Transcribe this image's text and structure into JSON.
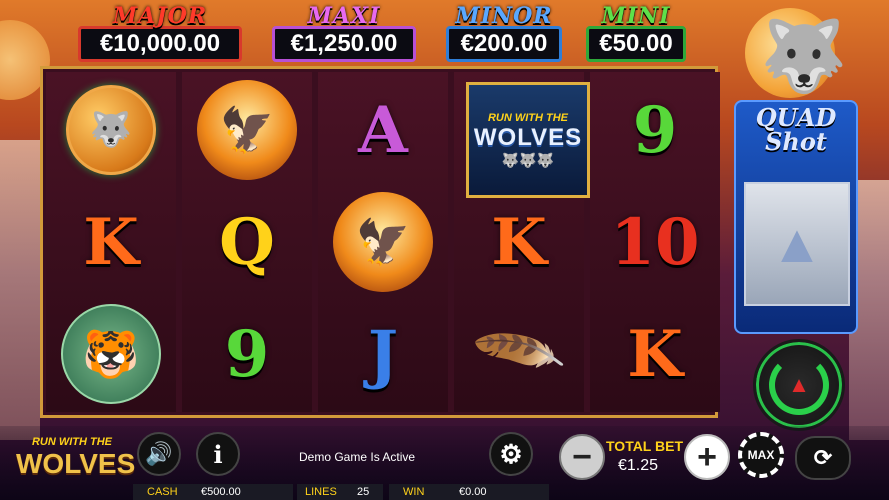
{
  "jackpots": [
    {
      "title": "MAJOR",
      "value": "€10,000.00"
    },
    {
      "title": "MAXI",
      "value": "€1,250.00"
    },
    {
      "title": "MINOR",
      "value": "€200.00"
    },
    {
      "title": "MINI",
      "value": "€50.00"
    }
  ],
  "reels": [
    [
      "wolf-coin",
      "eagle",
      "A"
    ],
    [
      "K",
      "Q",
      "eagle"
    ],
    [
      "lynx",
      "9",
      "J"
    ],
    [
      "logo",
      "K",
      "feather"
    ],
    [
      "9",
      "10",
      "K"
    ]
  ],
  "reel_grid_letters": {
    "r1c1": "K",
    "r2c1": "Q",
    "r2c2": "9",
    "r0c2": "A",
    "r3c1": "K",
    "r2c3": "J",
    "r4c0": "9",
    "r4c1": "10",
    "r4c2": "K"
  },
  "logo_symbol": {
    "top": "RUN WITH THE",
    "main": "WOLVES"
  },
  "quad_shot": {
    "title_line1": "QUAD",
    "title_line2": "Shot"
  },
  "bottom_logo": {
    "top": "RUN WITH THE",
    "main": "WOLVES"
  },
  "status": {
    "demo_text": "Demo Game Is Active"
  },
  "bet": {
    "label": "TOTAL BET",
    "value": "€1.25",
    "max_label": "MAX"
  },
  "stats": {
    "cash_label": "CASH",
    "cash_value": "€500.00",
    "lines_label": "LINES",
    "lines_value": "25",
    "win_label": "WIN",
    "win_value": "€0.00"
  },
  "colors": {
    "accent_green": "#2ad04a",
    "frame_gold": "#d29a3a"
  }
}
